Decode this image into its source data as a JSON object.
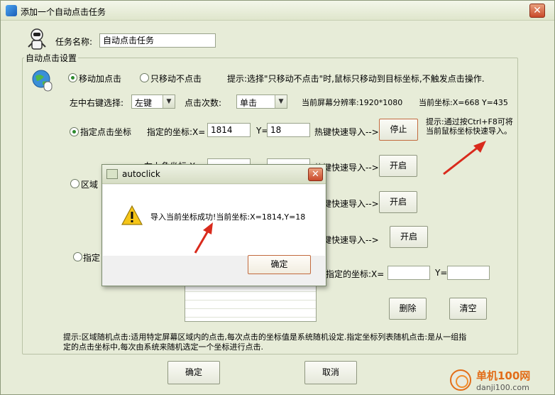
{
  "window": {
    "title": "添加一个自动点击任务",
    "close": "✕"
  },
  "task": {
    "name_label": "任务名称:",
    "name_value": "自动点击任务"
  },
  "settings": {
    "group_label": "自动点击设置",
    "radio_move_click": "移动加点击",
    "radio_move_only": "只移动不点击",
    "hint_move": "提示:选择\"只移动不点击\"时,鼠标只移动到目标坐标,不触发点击操作.",
    "button_select_label": "左中右键选择:",
    "button_select_value": "左键",
    "click_count_label": "点击次数:",
    "click_count_value": "单击",
    "resolution_label": "当前屏幕分辨率:1920*1080",
    "current_coord_label": "当前坐标:X=668  Y=435",
    "radio_fixed": "指定点击坐标",
    "fixed_coord_label": "指定的坐标:X=",
    "fixed_x": "1814",
    "y_label": "Y=",
    "fixed_y": "18",
    "hotkey_import": "热键快速导入-->",
    "stop_button": "停止",
    "hint_hotkey_line1": "提示:通过按Ctrl+F8可将",
    "hint_hotkey_line2": "当前鼠标坐标快速导入。",
    "region_partial_label": "左上角坐标:X=",
    "open_button": "开启",
    "radio_region": "区域",
    "radio_list": "指定",
    "list_coord_label": "指定的坐标:X=",
    "delete_button": "删除",
    "clear_button": "清空",
    "footer_hint_line1": "提示:区域随机点击:适用特定屏幕区域内的点击,每次点击的坐标值是系统随机设定.指定坐标列表随机点击:是从一组指",
    "footer_hint_line2": "定的点击坐标中,每次由系统来随机选定一个坐标进行点击."
  },
  "footer": {
    "ok": "确定",
    "cancel": "取消"
  },
  "dialog": {
    "title": "autoclick",
    "message": "导入当前坐标成功!当前坐标:X=1814,Y=18",
    "ok": "确定",
    "close": "✕"
  },
  "watermark": {
    "site": "单机100网",
    "url": "danji100.com"
  }
}
